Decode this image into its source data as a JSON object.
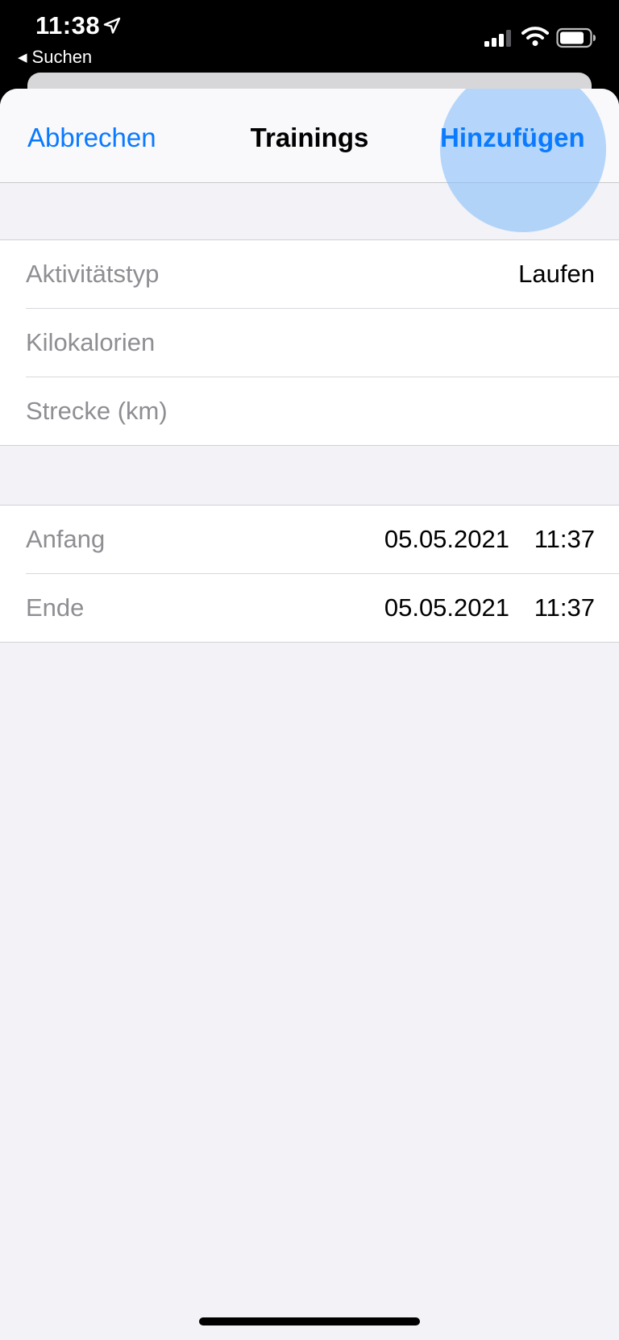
{
  "status_bar": {
    "time": "11:38",
    "back_app_label": "Suchen"
  },
  "nav": {
    "cancel_label": "Abbrechen",
    "title": "Trainings",
    "add_label": "Hinzufügen"
  },
  "workout": {
    "activity_label": "Aktivitätstyp",
    "activity_value": "Laufen",
    "kcal_label": "Kilokalorien",
    "distance_label": "Strecke (km)"
  },
  "time_range": {
    "start_label": "Anfang",
    "start_date": "05.05.2021",
    "start_time": "11:37",
    "end_label": "Ende",
    "end_date": "05.05.2021",
    "end_time": "11:37"
  },
  "colors": {
    "accent": "#0a7aff",
    "label_gray": "#8e8e93",
    "grouped_background": "#f2f2f7"
  },
  "icons": [
    "location-arrow-icon",
    "back-triangle-icon",
    "cellular-signal-icon",
    "wifi-icon",
    "battery-icon"
  ]
}
